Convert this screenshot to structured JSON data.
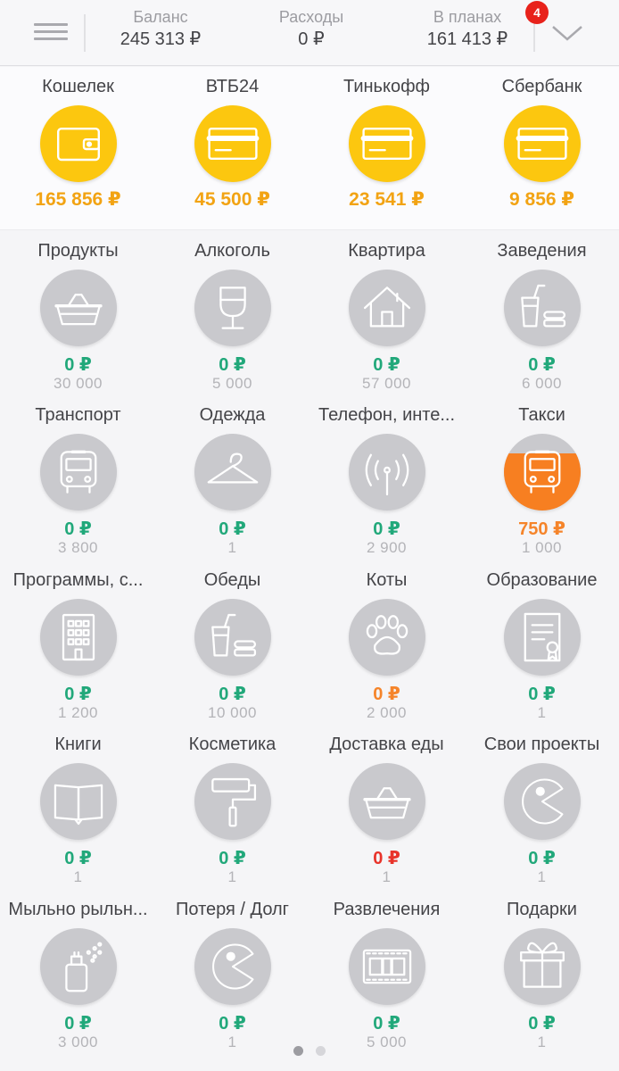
{
  "header": {
    "balance": {
      "label": "Баланс",
      "value": "245 313 ₽"
    },
    "expenses": {
      "label": "Расходы",
      "value": "0 ₽"
    },
    "planned": {
      "label": "В планах",
      "value": "161 413 ₽"
    },
    "badge_count": "4",
    "menu_icon": "hamburger-icon",
    "expand_icon": "chevron-down-icon"
  },
  "colors": {
    "account_circle": "#fcc70f",
    "account_amount": "#f2a313",
    "category_circle": "#c9c9cd",
    "spent_green": "#21a87a",
    "spent_orange": "#f5842a",
    "spent_red": "#e8332a",
    "overspend_fill": "#f77f21",
    "badge": "#e8221b"
  },
  "accounts": [
    {
      "name": "Кошелек",
      "amount": "165 856 ₽",
      "icon": "wallet-icon"
    },
    {
      "name": "ВТБ24",
      "amount": "45 500 ₽",
      "icon": "card-icon"
    },
    {
      "name": "Тинькофф",
      "amount": "23 541 ₽",
      "icon": "card-icon"
    },
    {
      "name": "Сбербанк",
      "amount": "9 856 ₽",
      "icon": "card-icon"
    }
  ],
  "categories": [
    {
      "name": "Продукты",
      "spent": "0 ₽",
      "budget": "30 000",
      "icon": "basket-icon",
      "status": "green"
    },
    {
      "name": "Алкоголь",
      "spent": "0 ₽",
      "budget": "5 000",
      "icon": "wine-glass-icon",
      "status": "green"
    },
    {
      "name": "Квартира",
      "spent": "0 ₽",
      "budget": "57 000",
      "icon": "house-icon",
      "status": "green"
    },
    {
      "name": "Заведения",
      "spent": "0 ₽",
      "budget": "6 000",
      "icon": "drink-burger-icon",
      "status": "green"
    },
    {
      "name": "Транспорт",
      "spent": "0 ₽",
      "budget": "3 800",
      "icon": "bus-icon",
      "status": "green"
    },
    {
      "name": "Одежда",
      "spent": "0 ₽",
      "budget": "1",
      "icon": "hanger-icon",
      "status": "green"
    },
    {
      "name": "Телефон, инте...",
      "spent": "0 ₽",
      "budget": "2 900",
      "icon": "antenna-icon",
      "status": "green"
    },
    {
      "name": "Такси",
      "spent": "750 ₽",
      "budget": "1 000",
      "icon": "bus-icon",
      "status": "orange",
      "fill": 0.75
    },
    {
      "name": "Программы, с...",
      "spent": "0 ₽",
      "budget": "1 200",
      "icon": "building-icon",
      "status": "green"
    },
    {
      "name": "Обеды",
      "spent": "0 ₽",
      "budget": "10 000",
      "icon": "drink-burger-icon",
      "status": "green"
    },
    {
      "name": "Коты",
      "spent": "0 ₽",
      "budget": "2 000",
      "icon": "paw-icon",
      "status": "orange"
    },
    {
      "name": "Образование",
      "spent": "0 ₽",
      "budget": "1",
      "icon": "certificate-icon",
      "status": "green"
    },
    {
      "name": "Книги",
      "spent": "0 ₽",
      "budget": "1",
      "icon": "book-icon",
      "status": "green"
    },
    {
      "name": "Косметика",
      "spent": "0 ₽",
      "budget": "1",
      "icon": "paint-roller-icon",
      "status": "green"
    },
    {
      "name": "Доставка еды",
      "spent": "0 ₽",
      "budget": "1",
      "icon": "basket-icon",
      "status": "red"
    },
    {
      "name": "Свои проекты",
      "spent": "0 ₽",
      "budget": "1",
      "icon": "pacman-icon",
      "status": "green"
    },
    {
      "name": "Мыльно рыльн...",
      "spent": "0 ₽",
      "budget": "3 000",
      "icon": "spray-bottle-icon",
      "status": "green"
    },
    {
      "name": "Потеря / Долг",
      "spent": "0 ₽",
      "budget": "1",
      "icon": "pacman-icon",
      "status": "green"
    },
    {
      "name": "Развлечения",
      "spent": "0 ₽",
      "budget": "5 000",
      "icon": "film-icon",
      "status": "green"
    },
    {
      "name": "Подарки",
      "spent": "0 ₽",
      "budget": "1",
      "icon": "gift-icon",
      "status": "green"
    }
  ],
  "pager": {
    "pages": 2,
    "current": 1
  }
}
